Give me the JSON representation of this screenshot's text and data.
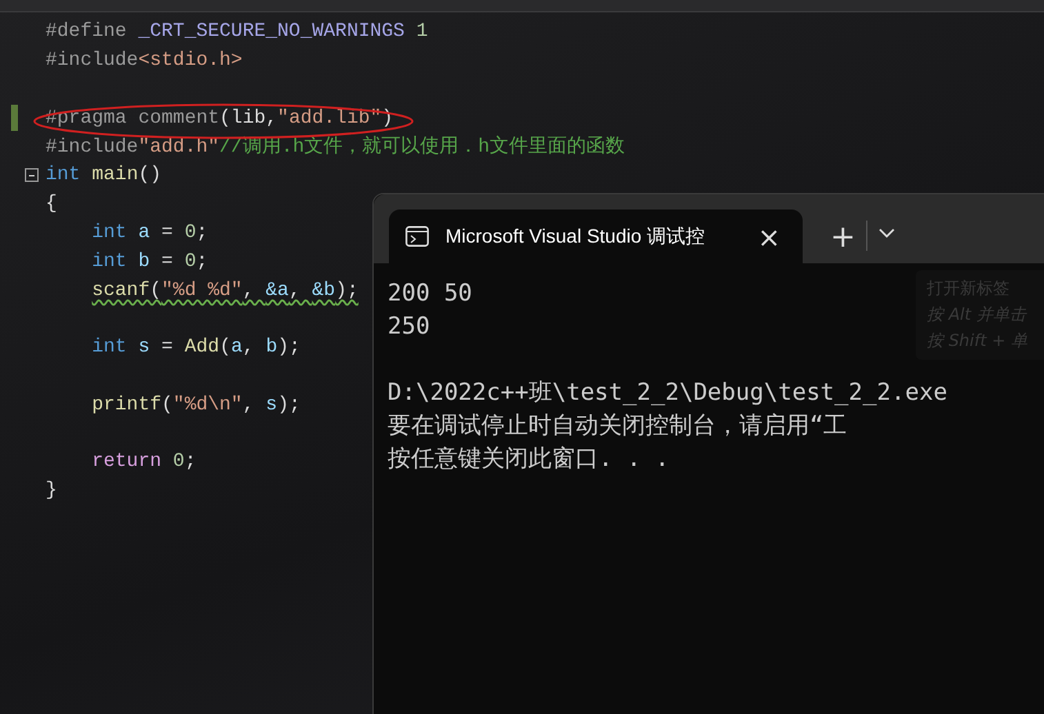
{
  "code_lines": [
    {
      "tokens": [
        {
          "kind": "directive",
          "text": "#define "
        },
        {
          "kind": "macro",
          "text": "_CRT_SECURE_NO_WARNINGS"
        },
        {
          "kind": "number",
          "text": " 1"
        }
      ]
    },
    {
      "tokens": [
        {
          "kind": "directive",
          "text": "#include"
        },
        {
          "kind": "string",
          "text": "<stdio.h>"
        }
      ]
    },
    {
      "blank_before": true,
      "changed": true,
      "circled": true,
      "tokens": [
        {
          "kind": "directive",
          "text": "#pragma comment"
        },
        {
          "kind": "plain",
          "text": "(lib,"
        },
        {
          "kind": "string",
          "text": "\"add.lib\""
        },
        {
          "kind": "plain",
          "text": ")"
        }
      ]
    },
    {
      "tokens": [
        {
          "kind": "directive",
          "text": "#include"
        },
        {
          "kind": "string",
          "text": "\"add.h\""
        },
        {
          "kind": "comment",
          "text": "//调用.h文件，就可以使用．h文件里面的函数"
        }
      ]
    },
    {
      "fold": true,
      "tokens": [
        {
          "kind": "keyword",
          "text": "int"
        },
        {
          "kind": "function",
          "text": " main"
        },
        {
          "kind": "plain",
          "text": "()"
        }
      ]
    },
    {
      "tokens": [
        {
          "kind": "plain",
          "text": "{"
        }
      ]
    },
    {
      "indent": true,
      "tokens": [
        {
          "kind": "keyword",
          "text": "int"
        },
        {
          "kind": "variable",
          "text": " a"
        },
        {
          "kind": "plain",
          "text": " = "
        },
        {
          "kind": "number",
          "text": "0"
        },
        {
          "kind": "plain",
          "text": ";"
        }
      ]
    },
    {
      "indent": true,
      "tokens": [
        {
          "kind": "keyword",
          "text": "int"
        },
        {
          "kind": "variable",
          "text": " b"
        },
        {
          "kind": "plain",
          "text": " = "
        },
        {
          "kind": "number",
          "text": "0"
        },
        {
          "kind": "plain",
          "text": ";"
        }
      ]
    },
    {
      "indent": true,
      "squiggle": true,
      "tokens": [
        {
          "kind": "function",
          "text": "scanf"
        },
        {
          "kind": "plain",
          "text": "("
        },
        {
          "kind": "string",
          "text": "\"%d %d\""
        },
        {
          "kind": "plain",
          "text": ", "
        },
        {
          "kind": "variable",
          "text": "&a"
        },
        {
          "kind": "plain",
          "text": ", "
        },
        {
          "kind": "variable",
          "text": "&b"
        },
        {
          "kind": "plain",
          "text": ");"
        }
      ]
    },
    {
      "blank_before": true,
      "indent": true,
      "tokens": [
        {
          "kind": "keyword",
          "text": "int"
        },
        {
          "kind": "variable",
          "text": " s"
        },
        {
          "kind": "plain",
          "text": " = "
        },
        {
          "kind": "function",
          "text": "Add"
        },
        {
          "kind": "plain",
          "text": "("
        },
        {
          "kind": "variable",
          "text": "a"
        },
        {
          "kind": "plain",
          "text": ", "
        },
        {
          "kind": "variable",
          "text": "b"
        },
        {
          "kind": "plain",
          "text": ");"
        }
      ]
    },
    {
      "blank_before": true,
      "indent": true,
      "tokens": [
        {
          "kind": "function",
          "text": "printf"
        },
        {
          "kind": "plain",
          "text": "("
        },
        {
          "kind": "string",
          "text": "\"%d\\n\""
        },
        {
          "kind": "plain",
          "text": ", "
        },
        {
          "kind": "variable",
          "text": "s"
        },
        {
          "kind": "plain",
          "text": ");"
        }
      ]
    },
    {
      "blank_before": true,
      "indent": true,
      "tokens": [
        {
          "kind": "control",
          "text": "return"
        },
        {
          "kind": "number",
          "text": " 0"
        },
        {
          "kind": "plain",
          "text": ";"
        }
      ]
    },
    {
      "tokens": [
        {
          "kind": "plain",
          "text": "}"
        }
      ]
    }
  ],
  "console": {
    "tab_title": "Microsoft Visual Studio 调试控",
    "close": "×",
    "new_tab": "+",
    "tooltip": [
      "打开新标签",
      "按 Alt 并单击",
      "按 Shift + 单"
    ],
    "output": [
      {
        "text": "200 50"
      },
      {
        "text": "250"
      },
      {
        "text": "D:\\2022c++班\\test_2_2\\Debug\\test_2_2.exe",
        "blank_before": true
      },
      {
        "text": "要在调试停止时自动关闭控制台，请启用“工"
      },
      {
        "text": "按任意键关闭此窗口. . ."
      }
    ]
  }
}
